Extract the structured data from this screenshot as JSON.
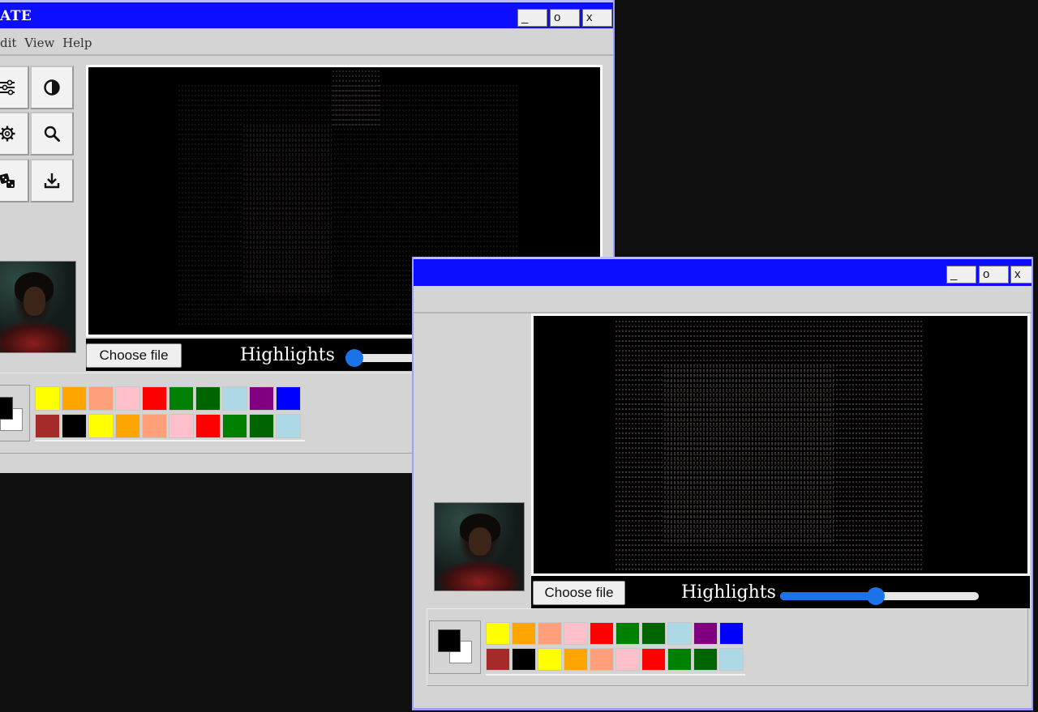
{
  "back_window": {
    "title": "ATE",
    "controls": {
      "minimize": "_",
      "maximize": "o",
      "close": "x"
    },
    "menu": [
      "dit",
      "View",
      "Help"
    ],
    "tools": [
      {
        "name": "sliders-icon"
      },
      {
        "name": "contrast-icon"
      },
      {
        "name": "gear-icon"
      },
      {
        "name": "search-icon"
      },
      {
        "name": "dice-icon"
      },
      {
        "name": "download-icon"
      }
    ],
    "choose_file_label": "Choose file",
    "highlights_label": "Highlights",
    "highlights_value": 0.0
  },
  "front_window": {
    "controls": {
      "minimize": "_",
      "maximize": "o",
      "close": "x"
    },
    "choose_file_label": "Choose file",
    "highlights_label": "Highlights",
    "highlights_value": 0.48
  },
  "palette": {
    "foreground": "#000000",
    "background": "#ffffff",
    "row1": [
      "#ffff00",
      "#ffa500",
      "#ffa07a",
      "#ffc0cb",
      "#ff0000",
      "#008000",
      "#006400",
      "#add8e6",
      "#800080",
      "#0000ff"
    ],
    "row2": [
      "#a52a2a",
      "#000000",
      "#ffff00",
      "#ffa500",
      "#ffa07a",
      "#ffc0cb",
      "#ff0000",
      "#008000",
      "#006400",
      "#add8e6"
    ]
  },
  "colors": {
    "desktop": "#0f0f10",
    "titlebar": "#0d0dff",
    "window_body": "#d4d4d4",
    "slider_accent": "#1a73e8"
  }
}
